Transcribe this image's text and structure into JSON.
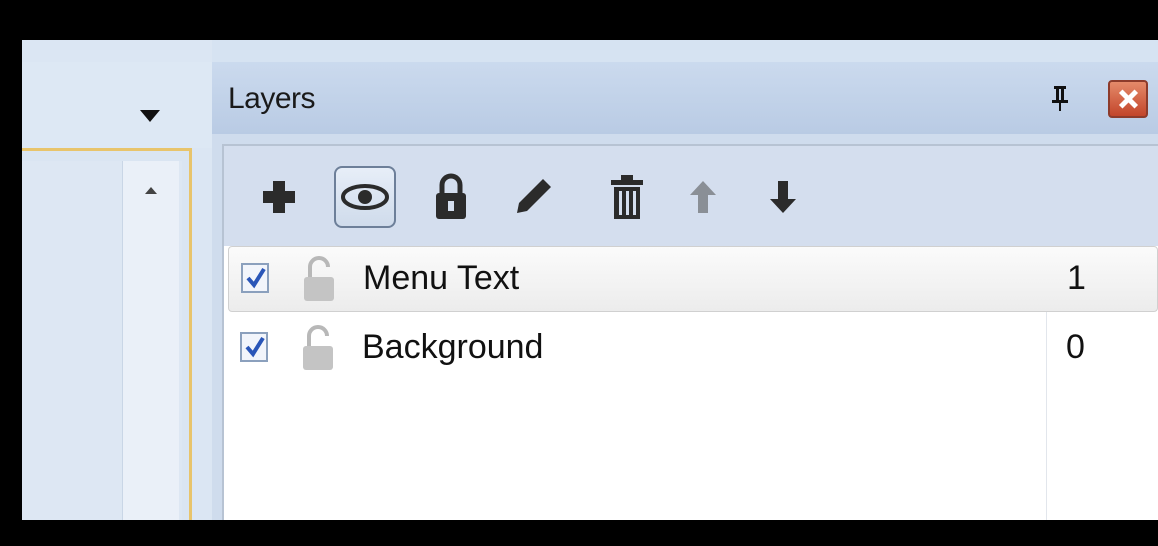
{
  "layers_panel": {
    "title": "Layers",
    "toolbar": [
      {
        "icon": "add-layer-icon",
        "active": false
      },
      {
        "icon": "eye-icon",
        "active": true
      },
      {
        "icon": "lock-icon",
        "active": false
      },
      {
        "icon": "pencil-icon",
        "active": false
      },
      {
        "icon": "trash-icon",
        "active": false
      },
      {
        "icon": "arrow-up-icon",
        "active": false
      },
      {
        "icon": "arrow-down-icon",
        "active": false
      }
    ],
    "layers": [
      {
        "name": "Menu Text",
        "index": "1",
        "visible": true,
        "locked": false,
        "selected": true
      },
      {
        "name": "Background",
        "index": "0",
        "visible": true,
        "locked": false,
        "selected": false
      }
    ]
  },
  "colors": {
    "title_bar": "#b9cbe4",
    "close_button": "#c2452a",
    "selection_border": "#e8c46b"
  }
}
